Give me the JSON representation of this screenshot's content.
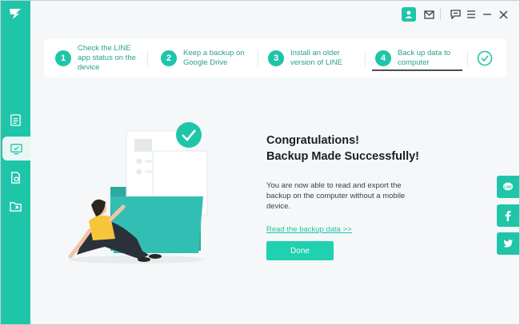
{
  "window": {
    "accent": "#1fc5a8",
    "titlebar_icons": [
      "user-avatar-icon",
      "mail-icon",
      "feedback-icon",
      "menu-icon",
      "minimize-icon",
      "close-icon"
    ]
  },
  "sidebar": {
    "items": [
      {
        "name": "document-icon",
        "active": false
      },
      {
        "name": "backup-icon",
        "active": true
      },
      {
        "name": "restore-icon",
        "active": false
      },
      {
        "name": "export-icon",
        "active": false
      }
    ]
  },
  "steps": [
    {
      "number": "1",
      "label": "Check the LINE app status on the device"
    },
    {
      "number": "2",
      "label": "Keep a backup on Google Drive"
    },
    {
      "number": "3",
      "label": "Install an older version of LINE"
    },
    {
      "number": "4",
      "label": "Back up data to computer"
    }
  ],
  "main": {
    "title_line1": "Congratulations!",
    "title_line2": "Backup Made Successfully!",
    "description": "You are now able to read and export the backup on the computer without a mobile device.",
    "link": "Read the backup data >>",
    "done_button": "Done"
  },
  "social": [
    "line-icon",
    "facebook-icon",
    "twitter-icon"
  ]
}
